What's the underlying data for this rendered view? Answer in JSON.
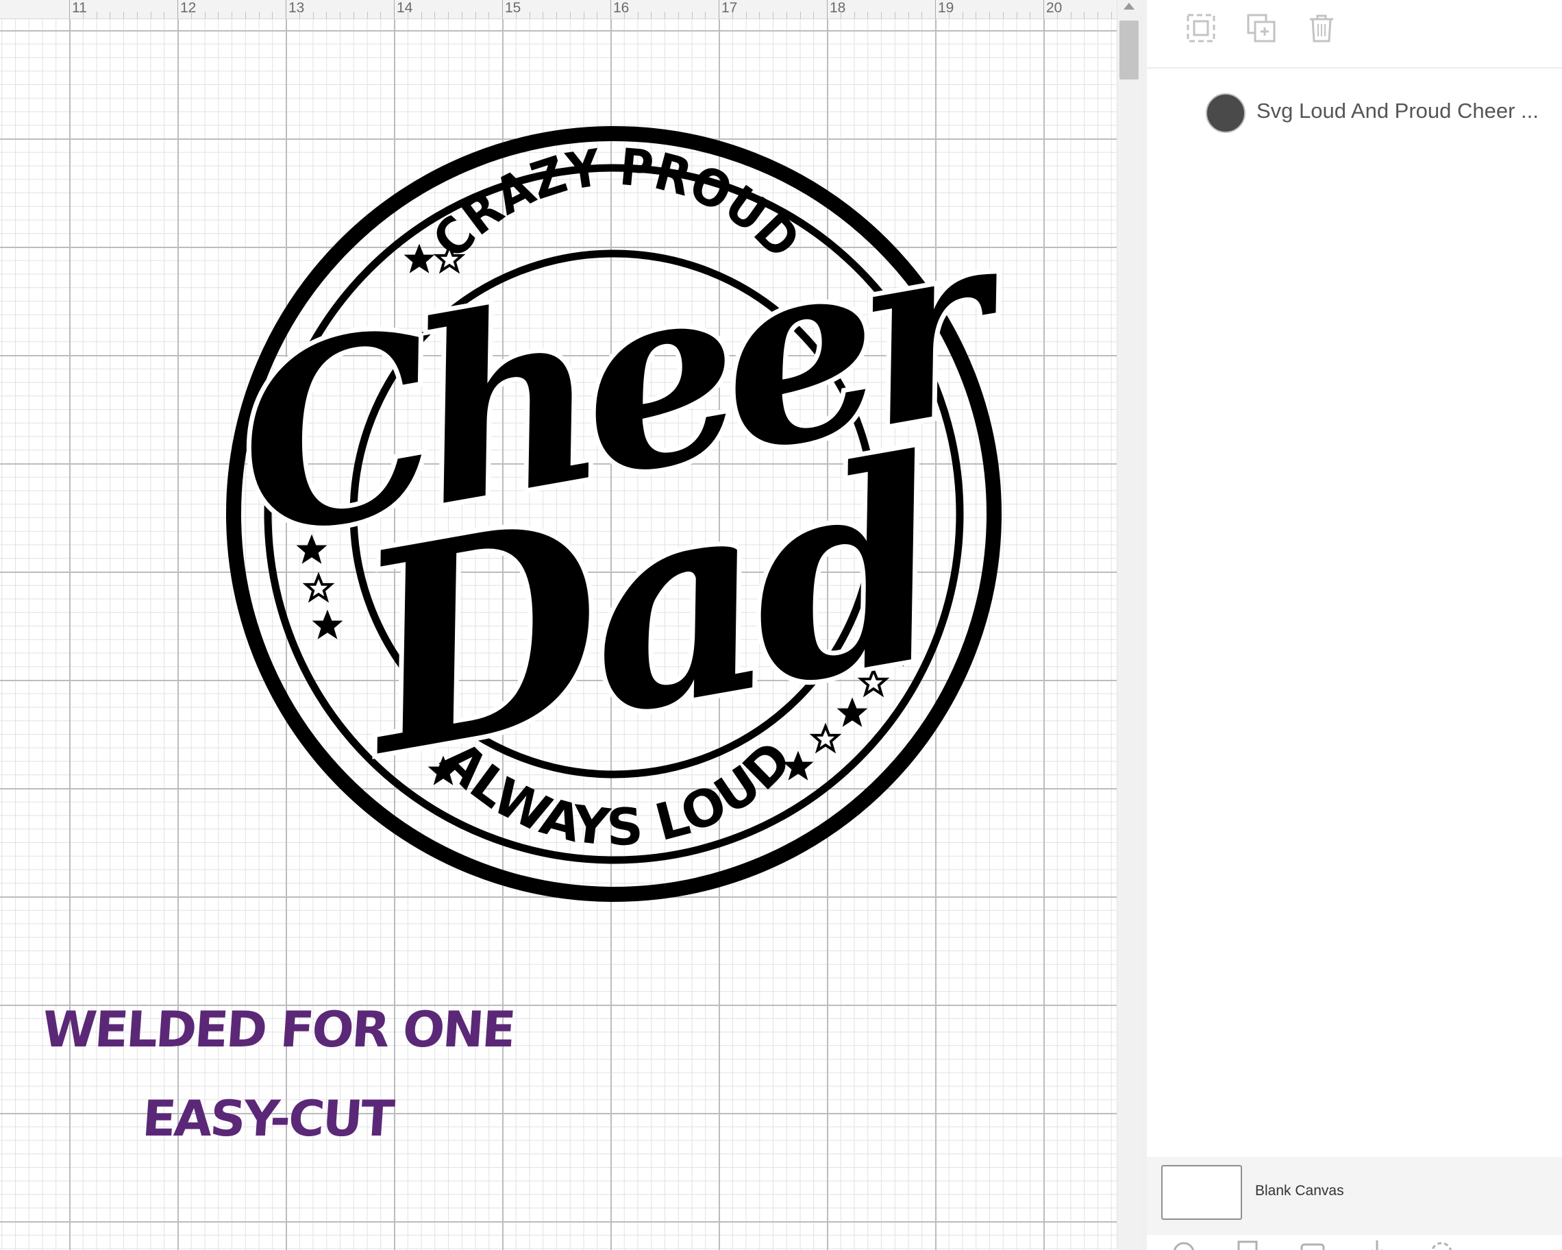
{
  "ruler": {
    "labels": [
      "11",
      "12",
      "13",
      "14",
      "15",
      "16",
      "17",
      "18",
      "19",
      "20"
    ]
  },
  "design": {
    "top_arc": "CRAZY PROUD",
    "script_word_1": "Cheer",
    "script_word_2": "Dad",
    "bottom_arc": "ALWAYS LOUD",
    "color": "#000000"
  },
  "notes": {
    "line1": "WELDED FOR ONE",
    "line2": "EASY-CUT",
    "color": "#5b2877"
  },
  "toolbar": {
    "icons": [
      "group-icon",
      "duplicate-icon",
      "delete-icon"
    ]
  },
  "layers": [
    {
      "name": "Svg Loud And Proud Cheer ...",
      "icon": "layer-thumbnail"
    }
  ],
  "canvas": {
    "label": "Blank Canvas"
  },
  "bottom_toolbar": {
    "icons": [
      "slice-icon",
      "combine-icon",
      "attach-icon",
      "flatten-icon",
      "contour-icon"
    ]
  }
}
